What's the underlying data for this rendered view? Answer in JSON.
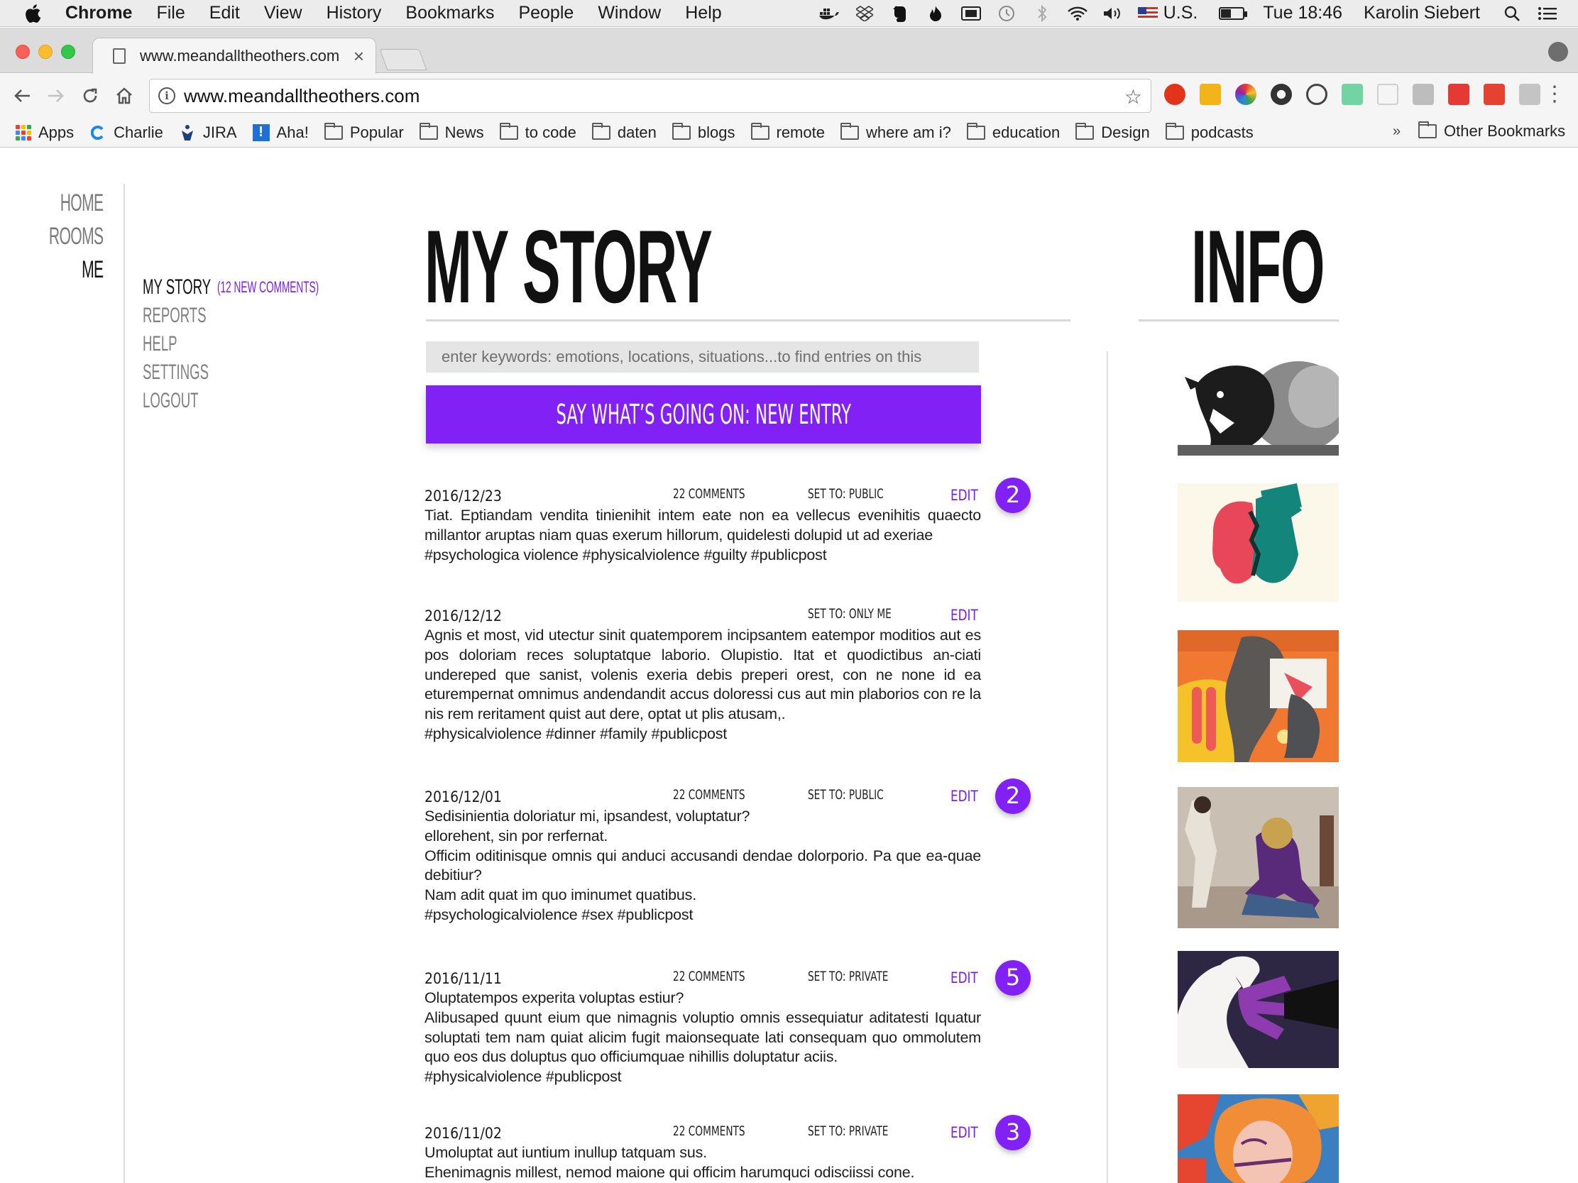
{
  "menubar": {
    "app": "Chrome",
    "menus": [
      "File",
      "Edit",
      "View",
      "History",
      "Bookmarks",
      "People",
      "Window",
      "Help"
    ],
    "input_source": "U.S.",
    "clock": "Tue 18:46",
    "user": "Karolin Siebert",
    "battery_level": 0.45
  },
  "browser": {
    "tab_title": "www.meandalltheothers.com",
    "url": "www.meandalltheothers.com",
    "bookmarks": {
      "apps": "Apps",
      "items": [
        "Charlie",
        "JIRA",
        "Aha!",
        "Popular",
        "News",
        "to code",
        "daten",
        "blogs",
        "remote",
        "where am i?",
        "education",
        "Design",
        "podcasts"
      ],
      "overflow": "»",
      "other": "Other Bookmarks"
    }
  },
  "site": {
    "main_nav": [
      "HOME",
      "ROOMS",
      "ME"
    ],
    "sub_nav": {
      "active": "MY STORY",
      "new_comments": "(12 NEW COMMENTS)",
      "items": [
        "REPORTS",
        "HELP",
        "SETTINGS",
        "LOGOUT"
      ]
    },
    "title": "MY STORY",
    "info_title": "INFO",
    "search_placeholder": "enter keywords: emotions, locations, situations...to find entries on this",
    "new_entry_label": "SAY WHAT’S GOING ON: NEW ENTRY",
    "edit_label": "EDIT",
    "entries": [
      {
        "date": "2016/12/23",
        "comments": "22 COMMENTS",
        "visibility": "SET TO: PUBLIC",
        "badge": "2",
        "body": "Tiat. Eptiandam vendita tinienihit intem eate non ea vellecus evenihitis quaecto millantor aruptas niam quas exerum hillorum, quidelesti dolupid ut ad exeriae\n#psychologica violence #physicalviolence #guilty #publicpost"
      },
      {
        "date": "2016/12/12",
        "comments": "",
        "visibility": "SET TO: ONLY ME",
        "badge": "",
        "body": "Agnis et most, vid utectur sinit quatemporem incipsantem eatempor moditios aut es pos doloriam reces soluptatque laborio. Olupistio. Itat et quodictibus an-ciati undereped que sanist, volenis exeria debis preperi orest, con ne none id ea eturempernat omnimus andendandit accus doloressi cus aut min plaborios con re la nis rem reritament quist aut dere, optat ut plis atusam,.\n#physicalviolence #dinner #family #publicpost"
      },
      {
        "date": "2016/12/01",
        "comments": "22 COMMENTS",
        "visibility": "SET TO: PUBLIC",
        "badge": "2",
        "body": "Sedisinientia doloriatur mi, ipsandest, voluptatur?\nellorehent, sin por rerfernat.\nOfficim oditinisque omnis qui anduci accusandi dendae dolorporio. Pa que ea-quae debitiur?\nNam adit quat im quo iminumet quatibus.\n#psychologicalviolence #sex #publicpost"
      },
      {
        "date": "2016/11/11",
        "comments": "22 COMMENTS",
        "visibility": "SET TO: PRIVATE",
        "badge": "5",
        "body": "Oluptatempos experita voluptas estiur?\nAlibusaped quunt eium que nimagnis voluptio omnis essequiatur aditatesti Iquatur soluptati tem nam quiat alicim fugit maionsequate lati consequam quo ommolutem quo eos dus doluptus quo officiumquae nihillis doluptatur aciis.\n#physicalviolence #publicpost"
      },
      {
        "date": "2016/11/02",
        "comments": "22 COMMENTS",
        "visibility": "SET TO: PRIVATE",
        "badge": "3",
        "body": "Umoluptat aut iuntium inullup tatquam sus.\nEhenimagnis millest, nemod maione qui officim harumquci odisciissi cone."
      }
    ],
    "info_images": [
      "illustration-black-bird-and-grey-animal",
      "illustration-red-and-teal-faces-top-hat",
      "illustration-orange-yellow-kitchen-scene",
      "photo-collage-woman-on-floor",
      "illustration-purple-hand-over-face",
      "illustration-woman-with-orange-hair"
    ]
  },
  "colors": {
    "accent": "#8121f5",
    "accent_text": "#7a1ef0",
    "nav_inactive": "#7a7a7a"
  }
}
